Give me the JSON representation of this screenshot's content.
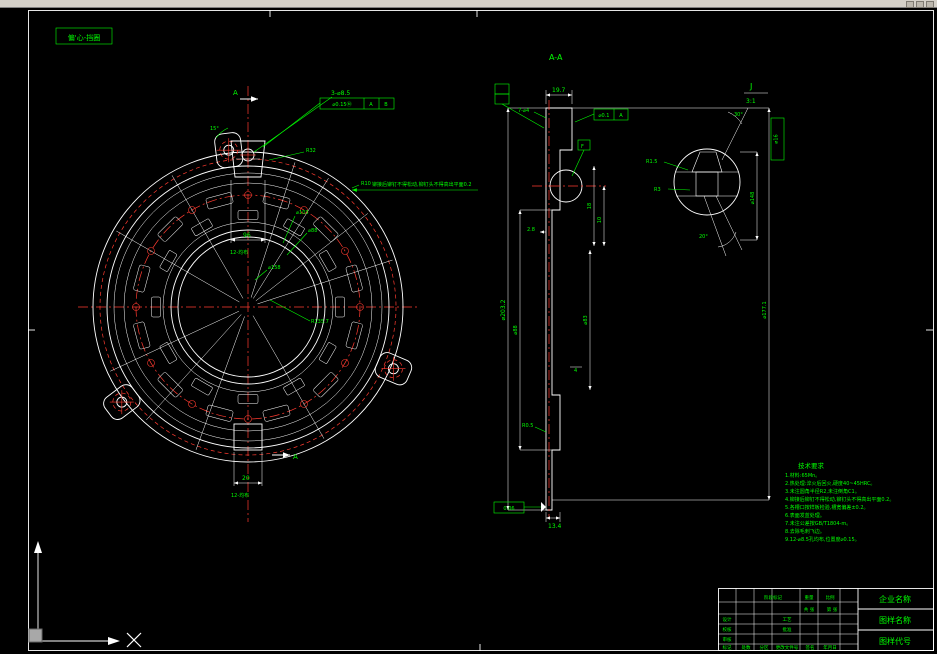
{
  "label_box": {
    "text": "偏'心-挡圈"
  },
  "front": {
    "sec_a": "A",
    "sec_a2": "A",
    "holes_callout": "3-⌀8.5",
    "fcf_val": "⌀0.15Ⓜ",
    "fcf_da": "A",
    "fcf_db": "B",
    "r32": "R32",
    "r10": "R10",
    "note": "铆接后铆钉不得松动,铆钉头不得高出平面0.2",
    "d103": "⌀103",
    "d88": "⌀88",
    "d158": "⌀158",
    "r135": "R135.7",
    "dim96": "96",
    "slots_a": "12-均布",
    "dim20": "20",
    "slots_b": "12-均布",
    "ang15": "15°"
  },
  "section": {
    "label": "A-A",
    "d19_7": "19.7",
    "holes7": "7-⌀4",
    "fcf_val": "⌀0.1",
    "fcf_da": "A",
    "datum_f": "F",
    "d2_8": "2.8",
    "d18": "18",
    "d10": "10",
    "d203": "⌀203.2",
    "d88": "⌀88",
    "d83": "⌀83",
    "d4": "4",
    "r05": "R0.5",
    "d13_4": "13.4",
    "fcf2": "0.06",
    "d148": "⌀148",
    "d177": "⌀177.1"
  },
  "detail": {
    "label": "J",
    "scale": "3:1",
    "a30": "30°",
    "a20": "20°",
    "r1_5": "R1.5",
    "r3": "R3",
    "d16": "⌀16"
  },
  "notes": {
    "title": "技术要求",
    "lines": [
      "1.材料:65Mn。",
      "2.热处理:淬火后回火,硬度40~45HRC。",
      "3.未注圆角半径R2,未注倒角C1。",
      "4.铆接后铆钉不得松动,铆钉头不得高出平面0.2。",
      "5.各槽口按样板检验,槽宽偏差±0.2。",
      "6.表面发蓝处理。",
      "7.未注公差按GB/T1804-m。",
      "8.去除毛刺飞边。",
      "9.12-⌀8.5孔均布,位置度⌀0.15。"
    ]
  },
  "tb": {
    "company": "企业名称",
    "name": "图样名称",
    "code": "图样代号",
    "sheji": "设计",
    "jiaohe": "校核",
    "shenhe": "审核",
    "gongyi": "工艺",
    "pizhun": "批准",
    "jieduan": "阶段标记",
    "zhongliang": "重量",
    "bili": "比例",
    "biaoji": "标记",
    "chushu": "处数",
    "fenqu": "分区",
    "wenjian": "更改文件号",
    "qianming": "签名",
    "nianyueri": "年月日",
    "gongzhang": "共 张",
    "dizhang": "第 张"
  },
  "colors": {
    "annotation": "#00ff00",
    "centerline": "#ff3b30",
    "geometry": "#ffffff"
  }
}
